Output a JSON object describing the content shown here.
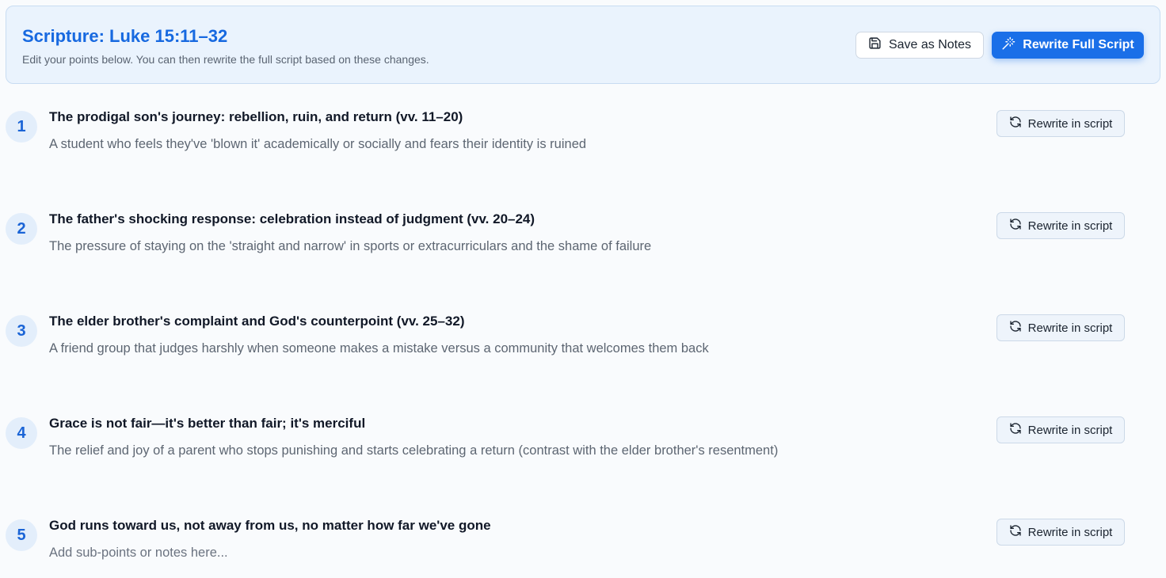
{
  "header": {
    "title": "Scripture: Luke 15:11–32",
    "subtitle": "Edit your points below. You can then rewrite the full script based on these changes.",
    "save_label": "Save as Notes",
    "save_icon": "floppy-disk-icon",
    "rewrite_full_label": "Rewrite Full Script",
    "rewrite_full_icon": "magic-wand-icon"
  },
  "colors": {
    "accent": "#1a6fe8",
    "title_blue": "#1769e0",
    "header_bg": "#eaf3fd",
    "badge_bg": "#e3eefb"
  },
  "points": [
    {
      "number": "1",
      "title": "The prodigal son's journey: rebellion, ruin, and return (vv. 11–20)",
      "subtitle": "A student who feels they've 'blown it' academically or socially and fears their identity is ruined",
      "button_label": "Rewrite in script"
    },
    {
      "number": "2",
      "title": "The father's shocking response: celebration instead of judgment (vv. 20–24)",
      "subtitle": "The pressure of staying on the 'straight and narrow' in sports or extracurriculars and the shame of failure",
      "button_label": "Rewrite in script"
    },
    {
      "number": "3",
      "title": "The elder brother's complaint and God's counterpoint (vv. 25–32)",
      "subtitle": "A friend group that judges harshly when someone makes a mistake versus a community that welcomes them back",
      "button_label": "Rewrite in script"
    },
    {
      "number": "4",
      "title": "Grace is not fair—it's better than fair; it's merciful",
      "subtitle": "The relief and joy of a parent who stops punishing and starts celebrating a return (contrast with the elder brother's resentment)",
      "button_label": "Rewrite in script"
    },
    {
      "number": "5",
      "title": "God runs toward us, not away from us, no matter how far we've gone",
      "subtitle": "Add sub-points or notes here...",
      "button_label": "Rewrite in script"
    }
  ],
  "rewrite_icon": "refresh-icon"
}
